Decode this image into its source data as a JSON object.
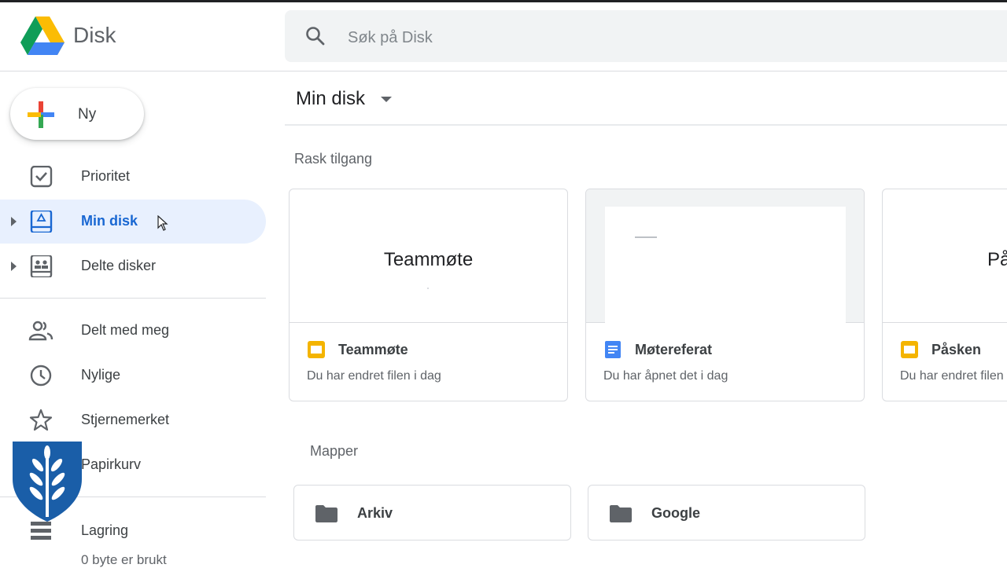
{
  "app": {
    "title": "Disk"
  },
  "search": {
    "placeholder": "Søk på Disk"
  },
  "sidebar": {
    "new_label": "Ny",
    "items": [
      {
        "label": "Prioritet",
        "icon": "checkbox-icon"
      },
      {
        "label": "Min disk",
        "icon": "drive-icon",
        "active": true
      },
      {
        "label": "Delte disker",
        "icon": "shared-drives-icon"
      },
      {
        "label": "Delt med meg",
        "icon": "people-icon"
      },
      {
        "label": "Nylige",
        "icon": "clock-icon"
      },
      {
        "label": "Stjernemerket",
        "icon": "star-icon"
      },
      {
        "label": "Papirkurv",
        "icon": "trash-icon"
      },
      {
        "label": "Lagring",
        "icon": "storage-icon"
      }
    ],
    "storage_used": "0 byte er brukt"
  },
  "main": {
    "title": "Min disk",
    "quick_access_label": "Rask tilgang",
    "quick_access": [
      {
        "name": "Teammøte",
        "type": "slides",
        "preview_text": "Teammøte",
        "subtitle": "Du har endret filen i dag"
      },
      {
        "name": "Møtereferat",
        "type": "docs",
        "preview_text": "",
        "subtitle": "Du har åpnet det i dag"
      },
      {
        "name": "Påsken",
        "type": "slides",
        "preview_text": "På",
        "subtitle": "Du har endret filen i dag"
      }
    ],
    "folders_label": "Mapper",
    "folders": [
      {
        "name": "Arkiv"
      },
      {
        "name": "Google"
      }
    ]
  },
  "colors": {
    "accent": "#1967d2",
    "active_bg": "#e8f0fe",
    "slides_yellow": "#f4b400",
    "docs_blue": "#4285f4",
    "shield_blue": "#1a5ea8"
  }
}
